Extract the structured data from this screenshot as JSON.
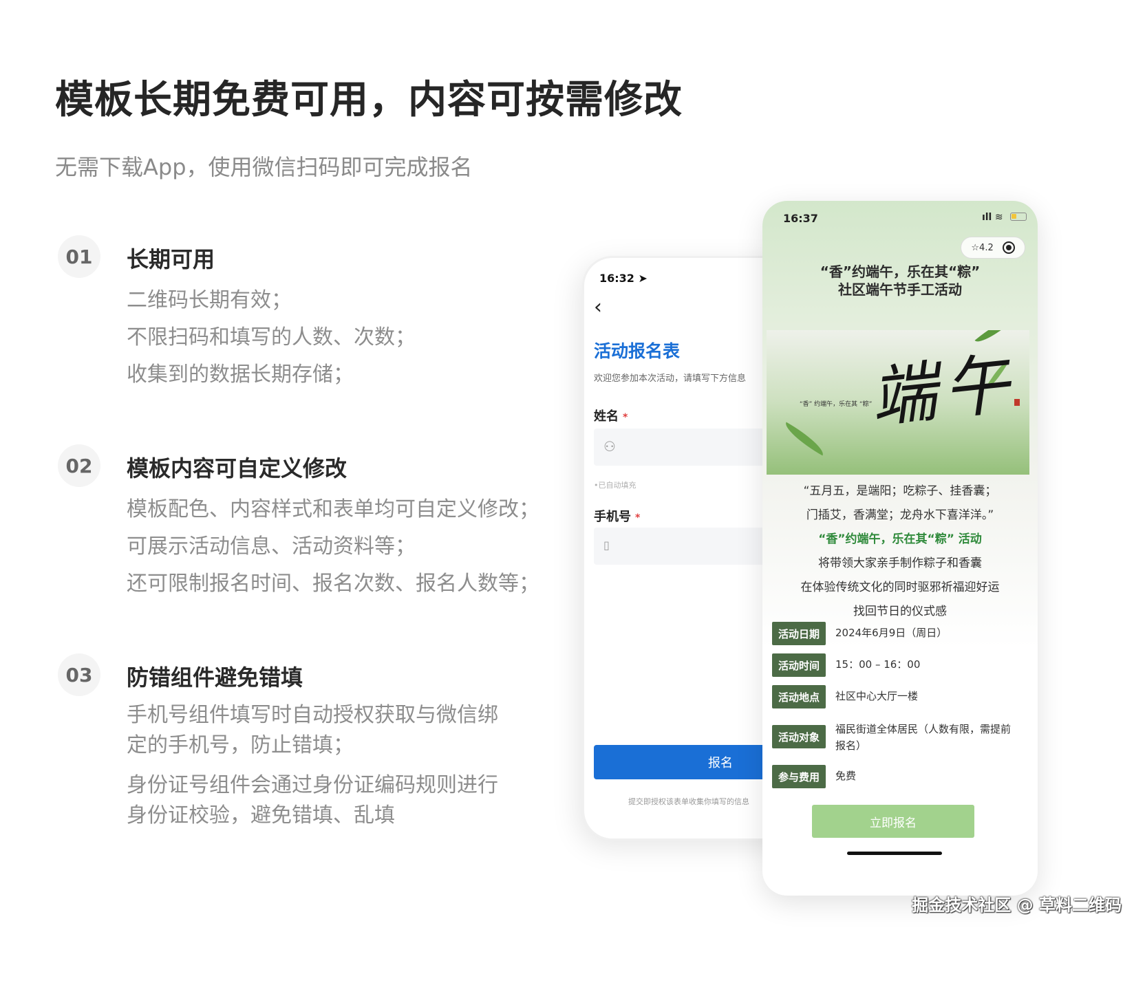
{
  "headline": "模板长期免费可用，内容可按需修改",
  "subline": "无需下载App，使用微信扫码即可完成报名",
  "features": [
    {
      "num": "01",
      "title": "长期可用",
      "lines": [
        "二维码长期有效；",
        "不限扫码和填写的人数、次数；",
        "收集到的数据长期存储；"
      ]
    },
    {
      "num": "02",
      "title": "模板内容可自定义修改",
      "lines": [
        "模板配色、内容样式和表单均可自定义修改；",
        "可展示活动信息、活动资料等；",
        "还可限制报名时间、报名次数、报名人数等；"
      ]
    },
    {
      "num": "03",
      "title": "防错组件避免错填",
      "paras": [
        "手机号组件填写时自动授权获取与微信绑定的手机号，防止错填；",
        "身份证号组件会通过身份证编码规则进行身份证校验，避免错填、乱填"
      ]
    }
  ],
  "phone1": {
    "time": "16:32",
    "form_title": "活动报名表",
    "form_desc": "欢迎您参加本次活动，请填写下方信息",
    "name_label": "姓名",
    "required_mark": "*",
    "autofill_note": "•已自动填充",
    "phone_label": "手机号",
    "submit_label": "报名",
    "footer": "提交即授权该表单收集你填写的信息"
  },
  "phone2": {
    "time": "16:37",
    "rating": "☆4.2",
    "title_line1": "“香”约端午，乐在其“粽”",
    "title_line2": "社区端午节手工活动",
    "banner_calligraphy": "端午",
    "banner_small": "“香” 约端午，乐在其 “粽”",
    "poem": [
      "“五月五，是端阳；吃粽子、挂香囊；",
      "门插艾，香满堂；龙舟水下喜洋洋。”",
      "“香”约端午，乐在其“粽” 活动",
      "将带领大家亲手制作粽子和香囊",
      "在体验传统文化的同时驱邪祈福迎好运",
      "找回节日的仪式感"
    ],
    "info": [
      {
        "tag": "活动日期",
        "value": "2024年6月9日（周日）"
      },
      {
        "tag": "活动时间",
        "value": "15：00 – 16：00"
      },
      {
        "tag": "活动地点",
        "value": "社区中心大厅一楼"
      },
      {
        "tag": "活动对象",
        "value": "福民街道全体居民（人数有限，需提前报名）"
      },
      {
        "tag": "参与费用",
        "value": "免费"
      }
    ],
    "signup_label": "立即报名"
  },
  "watermark": "掘金技术社区 @ 草料二维码",
  "colors": {
    "accent_blue": "#1a6fd6",
    "tag_green": "#4c6b46",
    "button_green": "#a2d28d",
    "poem_green": "#2f8a3b"
  }
}
